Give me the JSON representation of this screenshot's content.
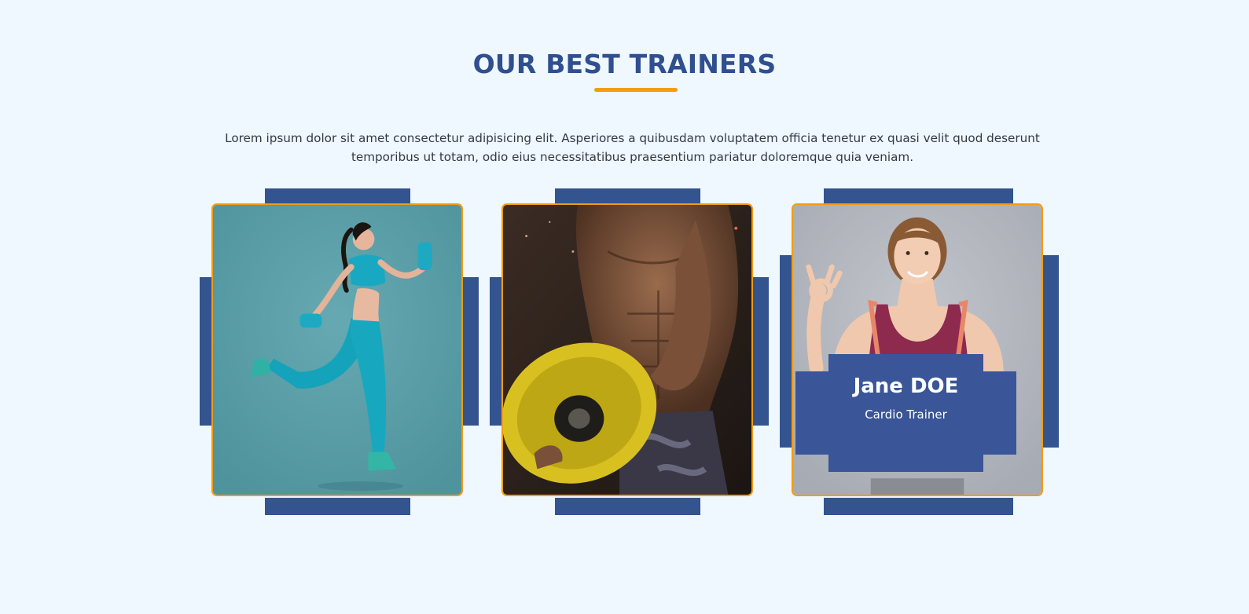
{
  "section": {
    "title": "OUR BEST TRAINERS",
    "description": "Lorem ipsum dolor sit amet consectetur adipisicing elit. Asperiores a quibusdam voluptatem officia tenetur ex quasi velit quod deserunt temporibus ut totam, odio eius necessitatibus praesentium pariatur doloremque quia veniam."
  },
  "trainers": [
    {
      "photo": "female-runner-with-dumbbells"
    },
    {
      "photo": "muscular-man-holding-weight-plate"
    },
    {
      "photo": "smiling-woman-ok-gesture",
      "name": "Jane DOE",
      "role": "Cardio Trainer"
    }
  ],
  "colors": {
    "background": "#eff7ff",
    "title": "#2f4f8f",
    "accent": "#f29c12",
    "frame": "#33548f",
    "info_box": "#3a5598"
  }
}
